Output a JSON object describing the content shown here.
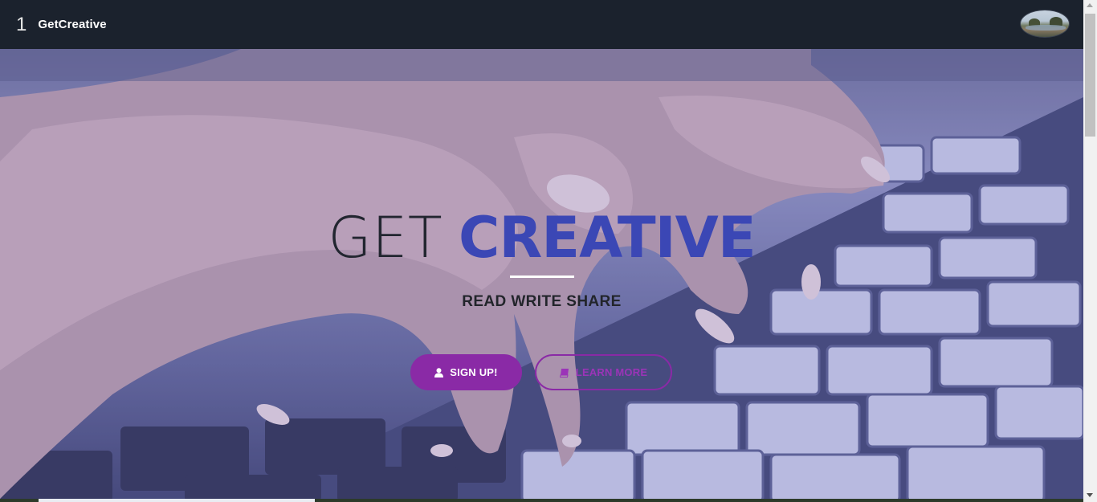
{
  "navbar": {
    "brand_number": "1",
    "brand_name": "GetCreative",
    "avatar_icon": "profile-photo-landscape"
  },
  "hero": {
    "title_light": "GET",
    "title_bold": "CREATIVE",
    "tagline": "READ WRITE SHARE",
    "background": "hands-typing-on-keyboard-photo",
    "signup_button": {
      "label": "SIGN UP!",
      "icon": "user-icon"
    },
    "learn_button": {
      "label": "LEARN MORE",
      "icon": "book-icon"
    }
  },
  "colors": {
    "navbar": "#1b222d",
    "accent_purple": "#8a2aa6",
    "title_blue": "#3b47b5",
    "title_dark": "#222630"
  },
  "page_load_progress": 0.25
}
